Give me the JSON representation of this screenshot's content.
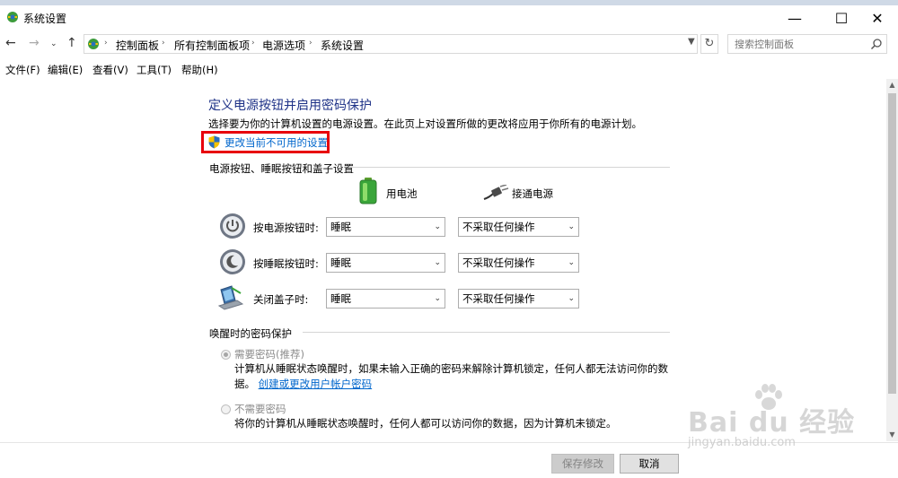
{
  "window": {
    "title": "系统设置",
    "minimize_label": "—",
    "maximize_label": "☐",
    "close_label": "✕"
  },
  "address_bar": {
    "breadcrumbs": [
      "控制面板",
      "所有控制面板项",
      "电源选项",
      "系统设置"
    ],
    "search_placeholder": "搜索控制面板"
  },
  "menu": {
    "items": [
      "文件(F)",
      "编辑(E)",
      "查看(V)",
      "工具(T)",
      "帮助(H)"
    ]
  },
  "content": {
    "heading": "定义电源按钮并启用密码保护",
    "description": "选择要为你的计算机设置的电源设置。在此页上对设置所做的更改将应用于你所有的电源计划。",
    "change_link": "更改当前不可用的设置",
    "power_section_title": "电源按钮、睡眠按钮和盖子设置",
    "columns": {
      "battery": "用电池",
      "plugged_in": "接通电源"
    },
    "rows": [
      {
        "label": "按电源按钮时:",
        "battery": "睡眠",
        "plugged_in": "不采取任何操作",
        "icon": "power-button-icon"
      },
      {
        "label": "按睡眠按钮时:",
        "battery": "睡眠",
        "plugged_in": "不采取任何操作",
        "icon": "sleep-button-icon"
      },
      {
        "label": "关闭盖子时:",
        "battery": "睡眠",
        "plugged_in": "不采取任何操作",
        "icon": "laptop-lid-icon"
      }
    ],
    "password_section_title": "唤醒时的密码保护",
    "require_password": {
      "label": "需要密码(推荐)",
      "desc_line1": "计算机从睡眠状态唤醒时，如果未输入正确的密码来解除计算机锁定，任何人都无法访问你的数",
      "desc_line2": "据。",
      "link": "创建或更改用户帐户密码",
      "selected": true
    },
    "no_password": {
      "label": "不需要密码",
      "desc": "将你的计算机从睡眠状态唤醒时，任何人都可以访问你的数据，因为计算机未锁定。",
      "selected": false
    }
  },
  "footer": {
    "save_label": "保存修改",
    "cancel_label": "取消"
  },
  "watermark": {
    "text": "Bai du 经验",
    "url": "jingyan.baidu.com"
  },
  "colors": {
    "heading": "#1e3287",
    "link": "#0066cc",
    "highlight_box": "#e8000b"
  }
}
